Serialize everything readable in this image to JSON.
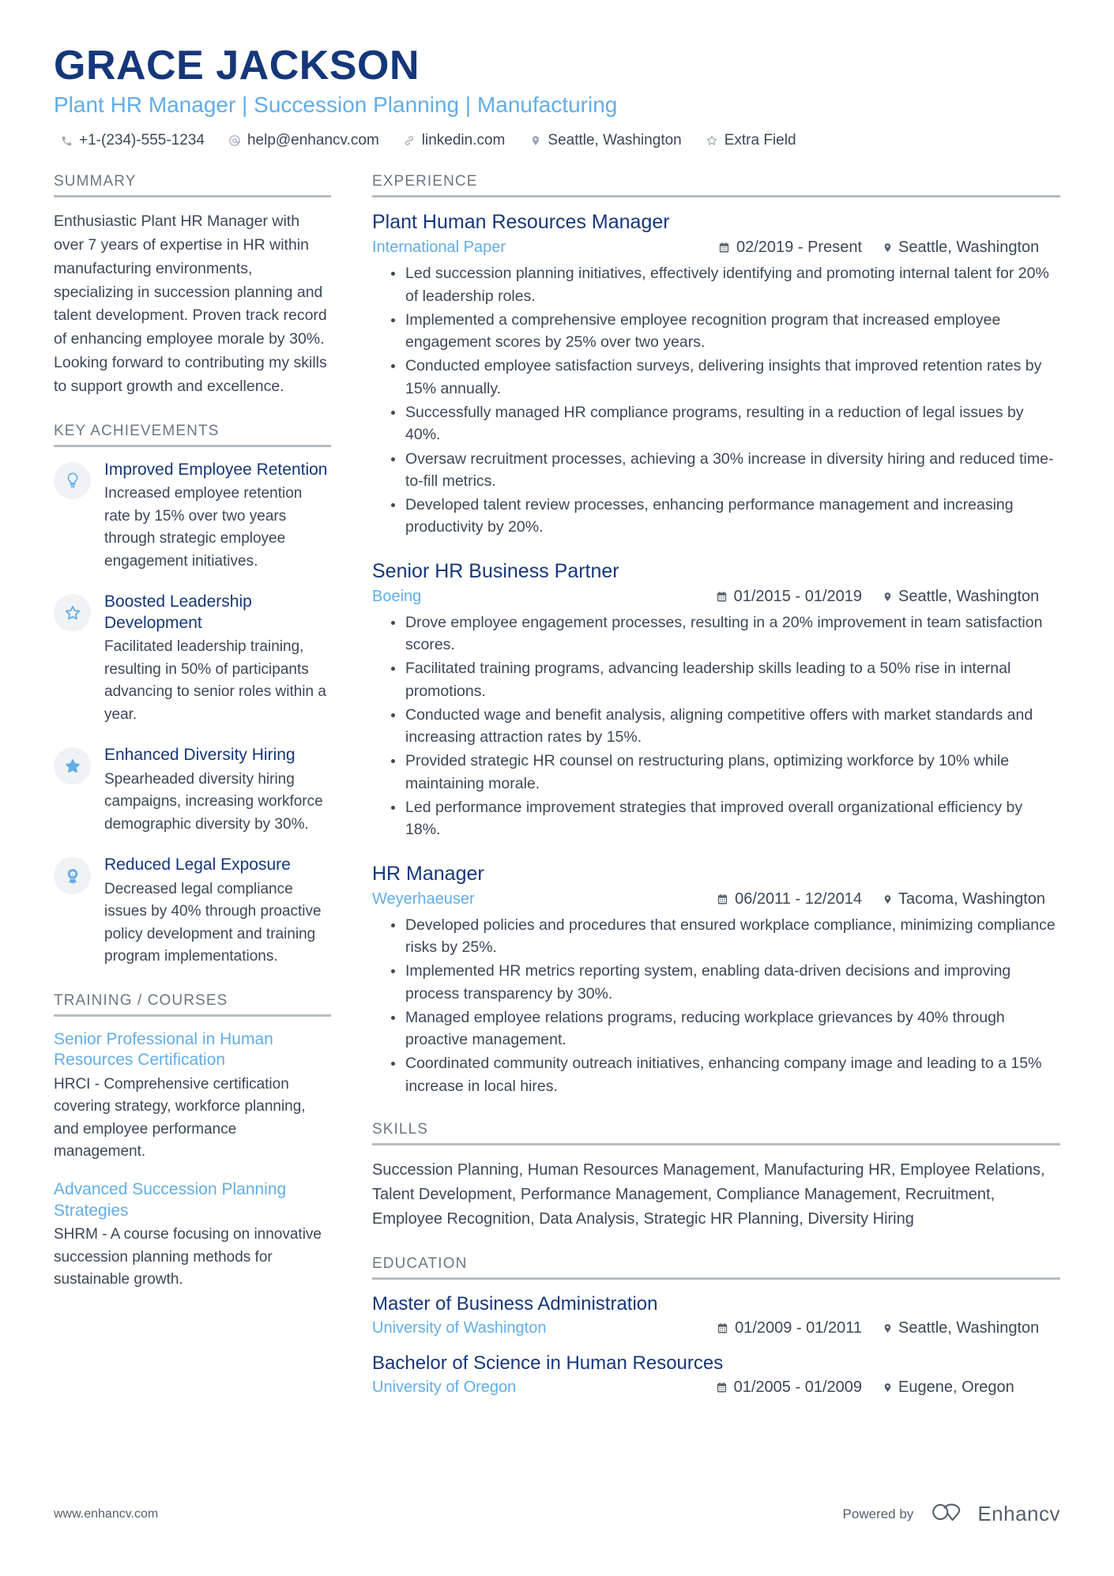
{
  "header": {
    "name": "GRACE JACKSON",
    "title": "Plant HR Manager | Succession Planning | Manufacturing",
    "contacts": [
      {
        "icon": "phone-icon",
        "text": "+1-(234)-555-1234"
      },
      {
        "icon": "email-icon",
        "text": "help@enhancv.com"
      },
      {
        "icon": "link-icon",
        "text": "linkedin.com"
      },
      {
        "icon": "location-pin-icon",
        "text": "Seattle, Washington"
      },
      {
        "icon": "star-outline-icon",
        "text": "Extra Field"
      }
    ]
  },
  "summary": {
    "heading": "SUMMARY",
    "text": "Enthusiastic Plant HR Manager with over 7 years of expertise in HR within manufacturing environments, specializing in succession planning and talent development. Proven track record of enhancing employee morale by 30%. Looking forward to contributing my skills to support growth and excellence."
  },
  "key_achievements": {
    "heading": "KEY ACHIEVEMENTS",
    "items": [
      {
        "icon": "lightbulb-icon",
        "title": "Improved Employee Retention",
        "description": "Increased employee retention rate by 15% over two years through strategic employee engagement initiatives."
      },
      {
        "icon": "star-outline-icon",
        "title": "Boosted Leadership Development",
        "description": "Facilitated leadership training, resulting in 50% of participants advancing to senior roles within a year."
      },
      {
        "icon": "star-filled-icon",
        "title": "Enhanced Diversity Hiring",
        "description": "Spearheaded diversity hiring campaigns, increasing workforce demographic diversity by 30%."
      },
      {
        "icon": "award-ribbon-icon",
        "title": "Reduced Legal Exposure",
        "description": "Decreased legal compliance issues by 40% through proactive policy development and training program implementations."
      }
    ]
  },
  "training": {
    "heading": "TRAINING / COURSES",
    "items": [
      {
        "title": "Senior Professional in Human Resources Certification",
        "description": "HRCI - Comprehensive certification covering strategy, workforce planning, and employee performance management."
      },
      {
        "title": "Advanced Succession Planning Strategies",
        "description": "SHRM - A course focusing on innovative succession planning methods for sustainable growth."
      }
    ]
  },
  "experience": {
    "heading": "EXPERIENCE",
    "items": [
      {
        "role": "Plant Human Resources Manager",
        "company": "International Paper",
        "dates": "02/2019 - Present",
        "location": "Seattle, Washington",
        "bullets": [
          "Led succession planning initiatives, effectively identifying and promoting internal talent for 20% of leadership roles.",
          "Implemented a comprehensive employee recognition program that increased employee engagement scores by 25% over two years.",
          "Conducted employee satisfaction surveys, delivering insights that improved retention rates by 15% annually.",
          "Successfully managed HR compliance programs, resulting in a reduction of legal issues by 40%.",
          "Oversaw recruitment processes, achieving a 30% increase in diversity hiring and reduced time-to-fill metrics.",
          "Developed talent review processes, enhancing performance management and increasing productivity by 20%."
        ]
      },
      {
        "role": "Senior HR Business Partner",
        "company": "Boeing",
        "dates": "01/2015 - 01/2019",
        "location": "Seattle, Washington",
        "bullets": [
          "Drove employee engagement processes, resulting in a 20% improvement in team satisfaction scores.",
          "Facilitated training programs, advancing leadership skills leading to a 50% rise in internal promotions.",
          "Conducted wage and benefit analysis, aligning competitive offers with market standards and increasing attraction rates by 15%.",
          "Provided strategic HR counsel on restructuring plans, optimizing workforce by 10% while maintaining morale.",
          "Led performance improvement strategies that improved overall organizational efficiency by 18%."
        ]
      },
      {
        "role": "HR Manager",
        "company": "Weyerhaeuser",
        "dates": "06/2011 - 12/2014",
        "location": "Tacoma, Washington",
        "bullets": [
          "Developed policies and procedures that ensured workplace compliance, minimizing compliance risks by 25%.",
          "Implemented HR metrics reporting system, enabling data-driven decisions and improving process transparency by 30%.",
          "Managed employee relations programs, reducing workplace grievances by 40% through proactive management.",
          "Coordinated community outreach initiatives, enhancing company image and leading to a 15% increase in local hires."
        ]
      }
    ]
  },
  "skills": {
    "heading": "SKILLS",
    "text": "Succession Planning, Human Resources Management, Manufacturing HR, Employee Relations, Talent Development, Performance Management, Compliance Management, Recruitment, Employee Recognition, Data Analysis, Strategic HR Planning, Diversity Hiring"
  },
  "education": {
    "heading": "EDUCATION",
    "items": [
      {
        "degree": "Master of Business Administration",
        "school": "University of Washington",
        "dates": "01/2009 - 01/2011",
        "location": "Seattle, Washington"
      },
      {
        "degree": "Bachelor of Science in Human Resources",
        "school": "University of Oregon",
        "dates": "01/2005 - 01/2009",
        "location": "Eugene, Oregon"
      }
    ]
  },
  "footer": {
    "website": "www.enhancv.com",
    "powered_by_label": "Powered by",
    "brand": "Enhancv"
  },
  "colors": {
    "name_navy": "#15377a",
    "accent_blue": "#62ade8",
    "body_gray": "#3c4858",
    "rule_gray": "#b7bcc2"
  }
}
